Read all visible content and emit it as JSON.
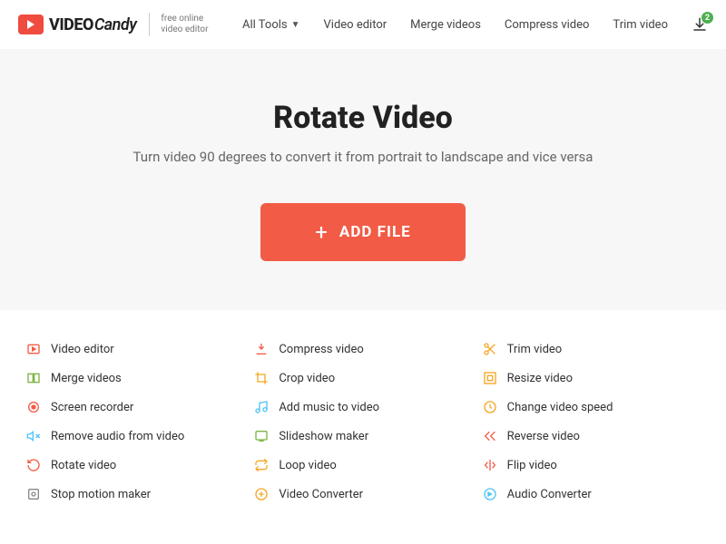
{
  "logo": {
    "text_video": "VIDEO",
    "text_candy": "Candy",
    "tagline_line1": "free online",
    "tagline_line2": "video editor"
  },
  "nav": {
    "all_tools": "All Tools",
    "video_editor": "Video editor",
    "merge_videos": "Merge videos",
    "compress_video": "Compress video",
    "trim_video": "Trim video",
    "download_badge": "2"
  },
  "hero": {
    "title": "Rotate Video",
    "subtitle": "Turn video 90 degrees to convert it from portrait to landscape and vice versa",
    "button": "ADD FILE"
  },
  "tools": {
    "col1": [
      "Video editor",
      "Merge videos",
      "Screen recorder",
      "Remove audio from video",
      "Rotate video",
      "Stop motion maker"
    ],
    "col2": [
      "Compress video",
      "Crop video",
      "Add music to video",
      "Slideshow maker",
      "Loop video",
      "Video Converter"
    ],
    "col3": [
      "Trim video",
      "Resize video",
      "Change video speed",
      "Reverse video",
      "Flip video",
      "Audio Converter"
    ]
  },
  "colors": {
    "accent": "#f25c46",
    "hero_bg": "#f7f7f7"
  }
}
